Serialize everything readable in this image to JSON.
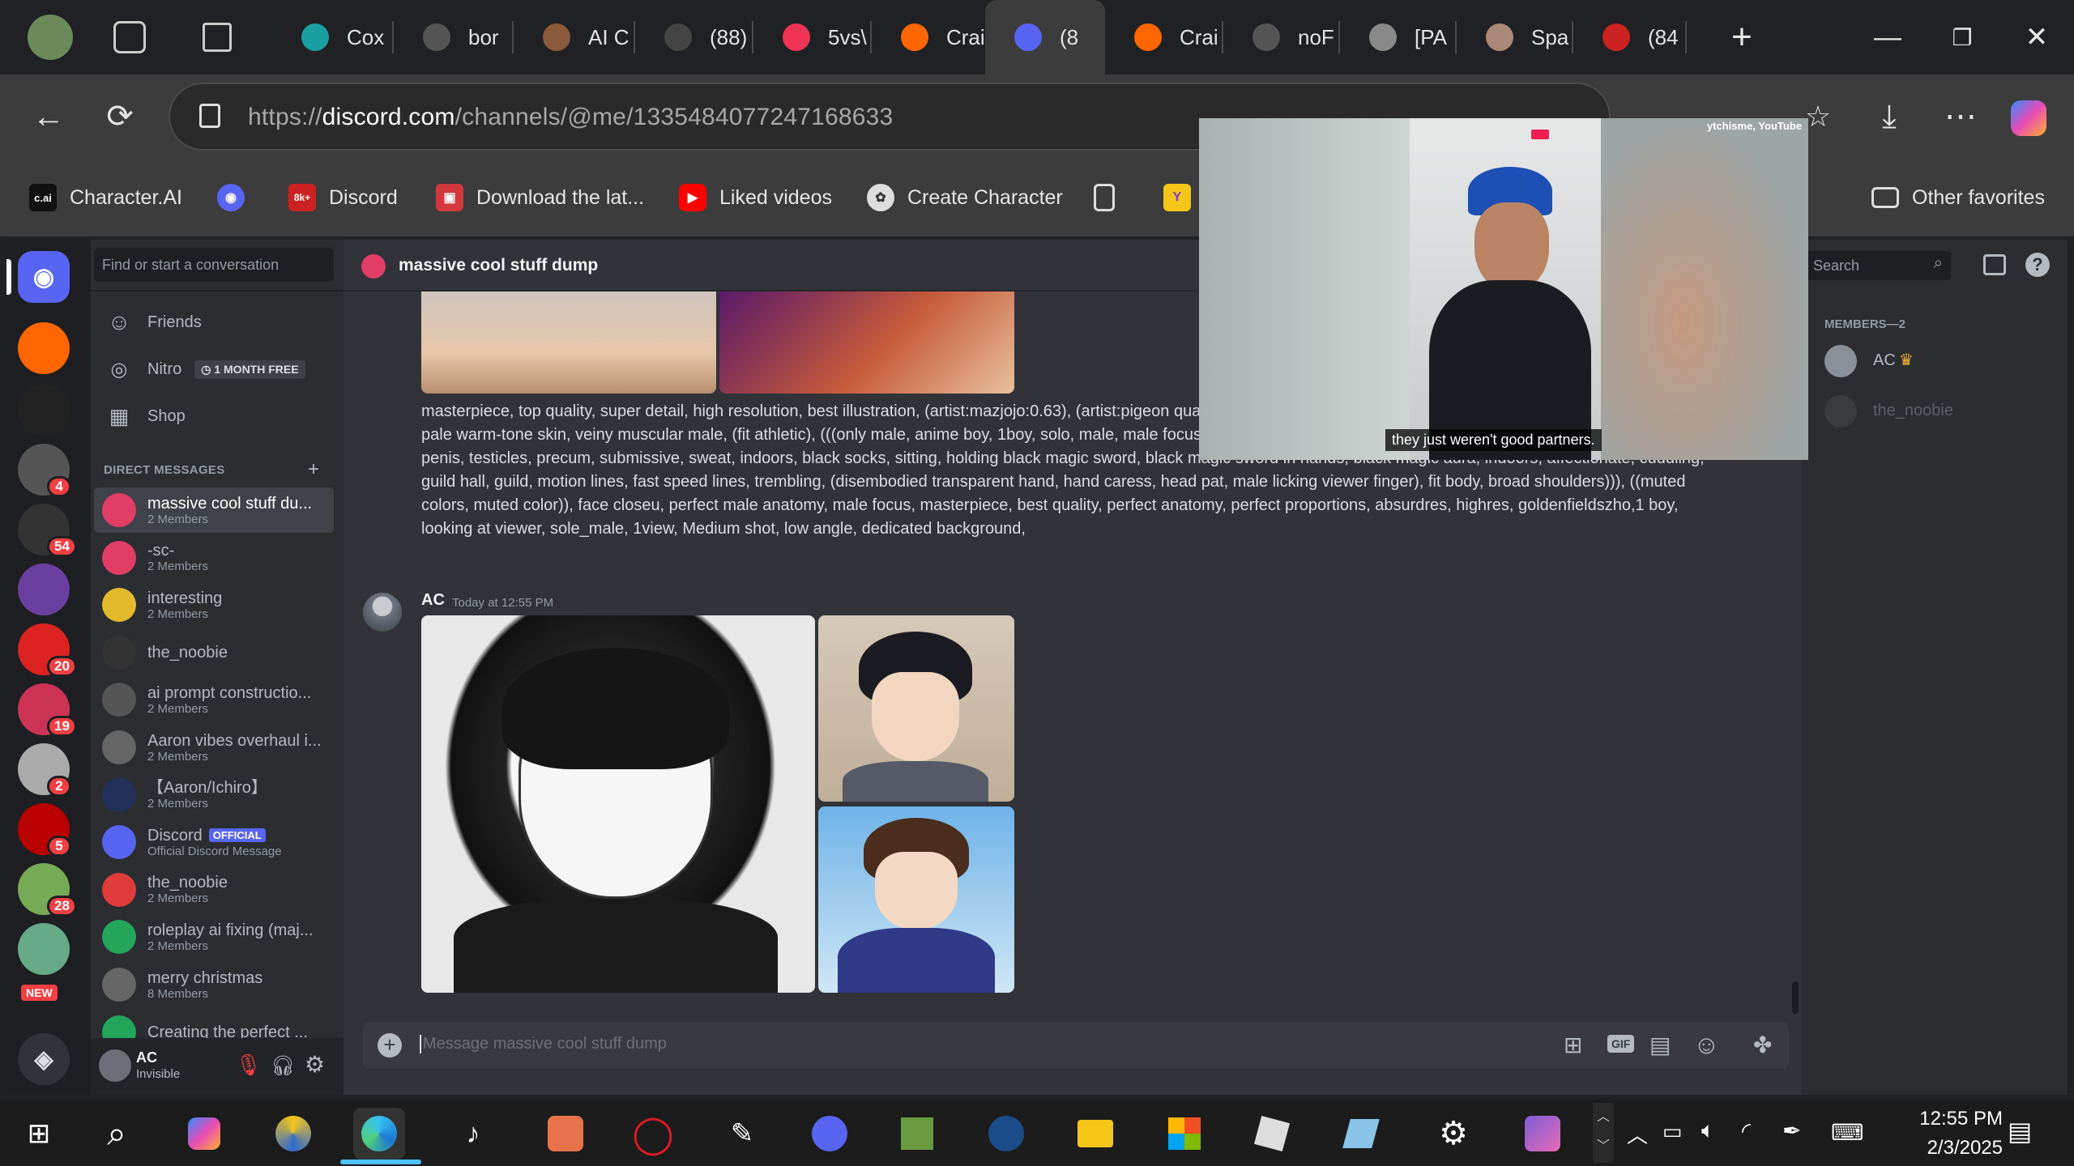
{
  "browser": {
    "tabs": [
      {
        "label": "Cox",
        "icon": "globe-icon",
        "color": "#1aa0a0"
      },
      {
        "label": "bor",
        "icon": "page-icon",
        "color": "#555"
      },
      {
        "label": "AI C",
        "icon": "avatar-icon",
        "color": "#8a5a3a"
      },
      {
        "label": "(88)",
        "icon": "media-icon",
        "color": "#444"
      },
      {
        "label": "5vs\\",
        "icon": "pinwheel-icon",
        "color": "#e35"
      },
      {
        "label": "Crai",
        "icon": "pencil-icon",
        "color": "#f60"
      },
      {
        "label": "(8",
        "icon": "discord-icon",
        "color": "#5865f2",
        "active": true
      },
      {
        "label": "Crai",
        "icon": "pencil-icon",
        "color": "#f60"
      },
      {
        "label": "noF",
        "icon": "page-icon",
        "color": "#555"
      },
      {
        "label": "[PA",
        "icon": "roblox-icon",
        "color": "#888"
      },
      {
        "label": "Spa",
        "icon": "frog-icon",
        "color": "#a87"
      },
      {
        "label": "(84",
        "icon": "badge-icon",
        "color": "#c22"
      }
    ],
    "url_prefix": "https://",
    "url_domain": "discord.com",
    "url_path": "/channels/@me/1335484077247168633",
    "favorites": [
      {
        "label": "Character.AI",
        "icon": "c.ai"
      },
      {
        "label": "",
        "icon": "discord-icon"
      },
      {
        "label": "Discord",
        "icon": "8k+"
      },
      {
        "label": "Download the lat...",
        "icon": "gift-icon"
      },
      {
        "label": "Liked videos",
        "icon": "youtube-icon"
      },
      {
        "label": "Create Character",
        "icon": "openai-icon"
      },
      {
        "label": "",
        "icon": "page-icon"
      },
      {
        "label": "",
        "icon": "y-icon"
      },
      {
        "label": "Other favorites",
        "icon": "folder-icon"
      }
    ]
  },
  "discord": {
    "search_placeholder": "Find or start a conversation",
    "nav": [
      {
        "label": "Friends"
      },
      {
        "label": "Nitro",
        "badge": "1 MONTH FREE"
      },
      {
        "label": "Shop"
      }
    ],
    "dm_header": "DIRECT MESSAGES",
    "dms": [
      {
        "name": "massive cool stuff du...",
        "sub": "2 Members",
        "color": "#e23d66",
        "selected": true
      },
      {
        "name": "-sc-",
        "sub": "2 Members",
        "color": "#e23d66"
      },
      {
        "name": "interesting",
        "sub": "2 Members",
        "color": "#e3b92c"
      },
      {
        "name": "the_noobie",
        "sub": "",
        "color": "#333"
      },
      {
        "name": "ai prompt constructio...",
        "sub": "2 Members",
        "color": "#555"
      },
      {
        "name": "Aaron vibes overhaul i...",
        "sub": "2 Members",
        "color": "#666"
      },
      {
        "name": "【Aaron/Ichiro】",
        "sub": "2 Members",
        "color": "#23305a"
      },
      {
        "name": "Discord",
        "sub": "Official Discord Message",
        "color": "#5865f2",
        "official": "OFFICIAL"
      },
      {
        "name": "the_noobie",
        "sub": "2 Members",
        "color": "#e03b3b"
      },
      {
        "name": "roleplay ai fixing (maj...",
        "sub": "2 Members",
        "color": "#23a55a"
      },
      {
        "name": "merry christmas",
        "sub": "8 Members",
        "color": "#666"
      },
      {
        "name": "Creating the perfect ...",
        "sub": "",
        "color": "#23a55a"
      }
    ],
    "user": {
      "name": "AC",
      "status": "Invisible"
    },
    "servers": [
      {
        "badge": "",
        "color": "#5865f2"
      },
      {
        "badge": "",
        "color": "#f60"
      },
      {
        "badge": "",
        "color": "#222"
      },
      {
        "badge": "4",
        "color": "#555"
      },
      {
        "badge": "54",
        "color": "#333"
      },
      {
        "badge": "",
        "color": "#6b3fa0"
      },
      {
        "badge": "20",
        "color": "#d22"
      },
      {
        "badge": "19",
        "color": "#c35"
      },
      {
        "badge": "2",
        "color": "#aaa"
      },
      {
        "badge": "5",
        "color": "#b00"
      },
      {
        "badge": "28",
        "color": "#7a5"
      },
      {
        "badge": "",
        "color": "#6a8"
      }
    ],
    "new_label": "NEW",
    "channel_title": "massive cool stuff dump",
    "header_search": "Search",
    "message_prompt": "masterpiece, top quality, super detail, high resolution, best illustration, (artist:mazjojo:0.63), (artist:pigeon quality, masterpiece, nai3, (Flat_color), fit athletic guy, ,short hair, ray tracing, pale warm-tone skin, veiny muscular male, (fit athletic), (((only male, anime boy, 1boy, solo, male, male focus, ((sanpaku eyes)), short hair, black t-shirt, shirt lift, hairy pubic hair, flaccid penis, testicles, precum, submissive, sweat, indoors, black socks, sitting, holding black magic sword, black magic sword in hands, black magic aura, indoors, affectionate, cuddling, guild hall, guild, motion lines, fast speed lines, trembling, (disembodied transparent hand, hand caress, head pat, male licking viewer finger), fit body, broad shoulders))), ((muted colors, muted color)), face closeu, perfect male anatomy, male focus, masterpiece, best quality, perfect anatomy, perfect proportions, absurdres, highres, goldenfieldszho,1 boy, looking at viewer, sole_male, 1view, Medium shot, low angle, dedicated background,",
    "message_author": "AC",
    "message_time": "Today at 12:55 PM",
    "composer_placeholder": "Message massive cool stuff dump",
    "members_header": "MEMBERS—2",
    "members": [
      {
        "name": "AC"
      },
      {
        "name": "the_noobie"
      }
    ]
  },
  "video_overlay": {
    "source": "ytchisme, YouTube",
    "caption": "they just weren't good partners."
  },
  "taskbar": {
    "time": "12:55 PM",
    "date": "2/3/2025"
  }
}
